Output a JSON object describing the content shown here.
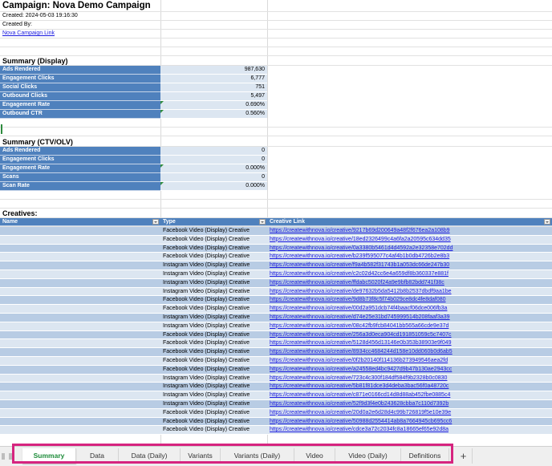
{
  "campaign": {
    "title": "Campaign: Nova Demo Campaign",
    "created": "Created: 2024-05-03 19:16:30",
    "created_by": "Created By:",
    "link_label": "Nova Campaign Link"
  },
  "summary_display": {
    "heading": "Summary (Display)",
    "rows": [
      {
        "label": "Ads Rendered",
        "value": "987,630",
        "flag": false
      },
      {
        "label": "Engagement Clicks",
        "value": "6,777",
        "flag": false
      },
      {
        "label": "Social Clicks",
        "value": "751",
        "flag": false
      },
      {
        "label": "Outbound Clicks",
        "value": "5,497",
        "flag": false
      },
      {
        "label": "Engagement Rate",
        "value": "0.690%",
        "flag": true
      },
      {
        "label": "Outbound CTR",
        "value": "0.560%",
        "flag": true
      }
    ]
  },
  "summary_ctv": {
    "heading": "Summary (CTV/OLV)",
    "rows": [
      {
        "label": "Ads Rendered",
        "value": "0",
        "flag": false
      },
      {
        "label": "Engagement Clicks",
        "value": "0",
        "flag": false
      },
      {
        "label": "Engagement Rate",
        "value": "0.000%",
        "flag": true
      },
      {
        "label": "Scans",
        "value": "0",
        "flag": false
      },
      {
        "label": "Scan Rate",
        "value": "0.000%",
        "flag": true
      }
    ]
  },
  "creatives": {
    "heading": "Creatives:",
    "columns": [
      "Name",
      "Type",
      "Creative Link"
    ],
    "rows": [
      {
        "name": "",
        "type": "Facebook Video (Display) Creative",
        "link": "https://createwithnova.io/creative/9217b69d200649a48f2f676ea2a108b9"
      },
      {
        "name": "",
        "type": "Facebook Video (Display) Creative",
        "link": "https://createwithnova.io/creative/18ed2326499c4a6fa2a20595c634dd35"
      },
      {
        "name": "",
        "type": "Facebook Video (Display) Creative",
        "link": "https://createwithnova.io/creative/0a3380b5461d4d4592a2e32358e702dd"
      },
      {
        "name": "",
        "type": "Facebook Video (Display) Creative",
        "link": "https://createwithnova.io/creative/b239f595077c4af4b1b0db4726b2e8b3"
      },
      {
        "name": "",
        "type": "Instagram Video (Display) Creative",
        "link": "https://createwithnova.io/creative/f9a4b582f31743b1a053dc66de247b30"
      },
      {
        "name": "",
        "type": "Instagram Video (Display) Creative",
        "link": "https://createwithnova.io/creative/c2c02d42cc6e4a659df8b360337e881f"
      },
      {
        "name": "",
        "type": "Instagram Video (Display) Creative",
        "link": "https://createwithnova.io/creative/ffdabc5020f24a9e9bfb82bdd741f38c"
      },
      {
        "name": "",
        "type": "Instagram Video (Display) Creative",
        "link": "https://createwithnova.io/creative/de97632b5da5412b8b2537dbdf9aa1be"
      },
      {
        "name": "",
        "type": "Facebook Video (Display) Creative",
        "link": "https://createwithnova.io/creative/9d8b73f8c5f74b029ce8dc4fe8daf080"
      },
      {
        "name": "",
        "type": "Facebook Video (Display) Creative",
        "link": "https://createwithnova.io/creative/00d2a951dcb74f4baacf06dce006fb3a"
      },
      {
        "name": "",
        "type": "Instagram Video (Display) Creative",
        "link": "https://createwithnova.io/creative/d74e25e31bd745999514b208faaf3a39"
      },
      {
        "name": "",
        "type": "Instagram Video (Display) Creative",
        "link": "https://createwithnova.io/creative/08c42fb9fcb84041bb565a66cde9e37d"
      },
      {
        "name": "",
        "type": "Facebook Video (Display) Creative",
        "link": "https://createwithnova.io/creative/256a3d0eca904cd191851059c5c7407c"
      },
      {
        "name": "",
        "type": "Facebook Video (Display) Creative",
        "link": "https://createwithnova.io/creative/5128d456d13146e0b353b38903e9f049"
      },
      {
        "name": "",
        "type": "Facebook Video (Display) Creative",
        "link": "https://createwithnova.io/creative/8934cc4684244d158e10dd060b0d6ab5"
      },
      {
        "name": "",
        "type": "Facebook Video (Display) Creative",
        "link": "https://createwithnova.io/creative/0f2b20140f114136b273949546aea2fd"
      },
      {
        "name": "",
        "type": "Facebook Video (Display) Creative",
        "link": "https://createwithnova.io/creative/a24558ed4bc9427d9b47b130ae2943cc"
      },
      {
        "name": "",
        "type": "Instagram Video (Display) Creative",
        "link": "https://createwithnova.io/creative/723c4c300f184df584f9b2328b0c0830"
      },
      {
        "name": "",
        "type": "Instagram Video (Display) Creative",
        "link": "https://createwithnova.io/creative/5b81f81dce3d4deba3bac56f0a48720c"
      },
      {
        "name": "",
        "type": "Instagram Video (Display) Creative",
        "link": "https://createwithnova.io/creative/c871e0166cd14d8d88ab452fbe0885c4"
      },
      {
        "name": "",
        "type": "Instagram Video (Display) Creative",
        "link": "https://createwithnova.io/creative/52f9d3f4e0b243628cbba7c110d7392b"
      },
      {
        "name": "",
        "type": "Facebook Video (Display) Creative",
        "link": "https://createwithnova.io/creative/20d0a2e6d28d4c99b726819f5e10e39e"
      },
      {
        "name": "",
        "type": "Facebook Video (Display) Creative",
        "link": "https://createwithnova.io/creative/50988d2554414ab8a7664945cb695cc6"
      },
      {
        "name": "",
        "type": "Facebook Video (Display) Creative",
        "link": "https://createwithnova.io/creative/cdce3a72c2034fc8a18665ef65e92d8a"
      }
    ]
  },
  "tabs": {
    "items": [
      "Summary",
      "Data",
      "Data (Daily)",
      "Variants",
      "Variants (Daily)",
      "Video",
      "Video (Daily)",
      "Definitions"
    ],
    "active_index": 0,
    "add_label": "+"
  },
  "colors": {
    "header_blue": "#4f81bd",
    "band_dark": "#b8cce4",
    "band_light": "#dce6f1",
    "active_tab": "#1e8c3a",
    "highlight": "#d6247f"
  }
}
